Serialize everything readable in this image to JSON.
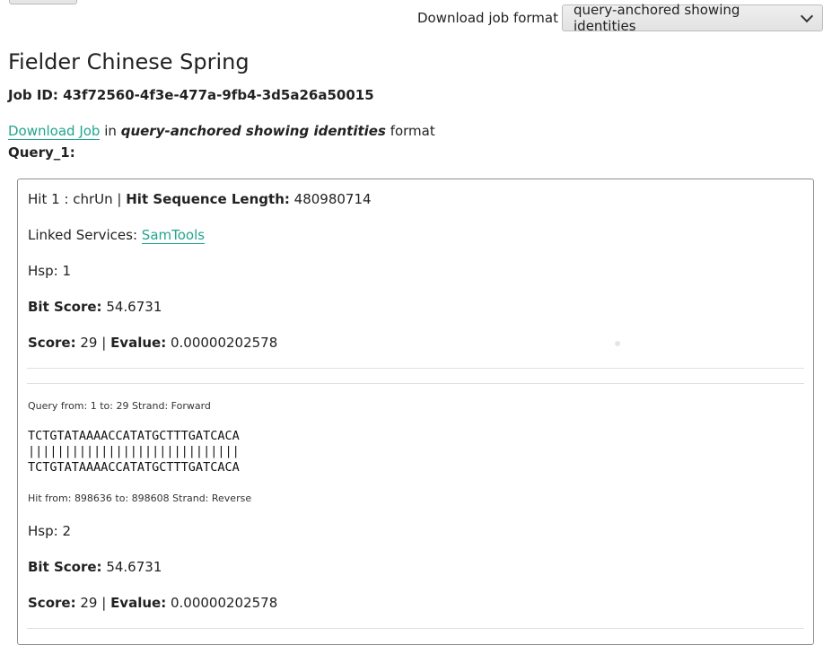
{
  "header": {
    "download_format_label": "Download job format",
    "download_format_selected": "query-anchored showing identities"
  },
  "page": {
    "title": "Fielder Chinese Spring",
    "job_id_text": "Job ID: 43f72560-4f3e-477a-9fb4-3d5a26a50015",
    "download_link": "Download Job",
    "download_in": "in",
    "download_format": "query-anchored showing identities",
    "download_suffix": "format",
    "query_label": "Query_1:"
  },
  "hit": {
    "hit_prefix": "Hit 1 : chrUn |",
    "hit_length_label": "Hit Sequence Length:",
    "hit_length_value": "480980714",
    "linked_label": "Linked Services:",
    "linked_link": "SamTools",
    "hsps": [
      {
        "hsp_text": "Hsp: 1",
        "bit_label": "Bit Score:",
        "bit_value": "54.6731",
        "score_label": "Score:",
        "score_value": "29 |",
        "evalue_label": "Evalue:",
        "evalue_value": "0.00000202578",
        "query_from": "Query from: 1 to: 29 Strand: Forward",
        "seq_query": "TCTGTATAAAACCATATGCTTTGATCACA",
        "seq_match": "|||||||||||||||||||||||||||||",
        "seq_hit": "TCTGTATAAAACCATATGCTTTGATCACA",
        "hit_from": "Hit from: 898636 to: 898608 Strand: Reverse"
      },
      {
        "hsp_text": "Hsp: 2",
        "bit_label": "Bit Score:",
        "bit_value": "54.6731",
        "score_label": "Score:",
        "score_value": "29 |",
        "evalue_label": "Evalue:",
        "evalue_value": "0.00000202578"
      }
    ]
  }
}
